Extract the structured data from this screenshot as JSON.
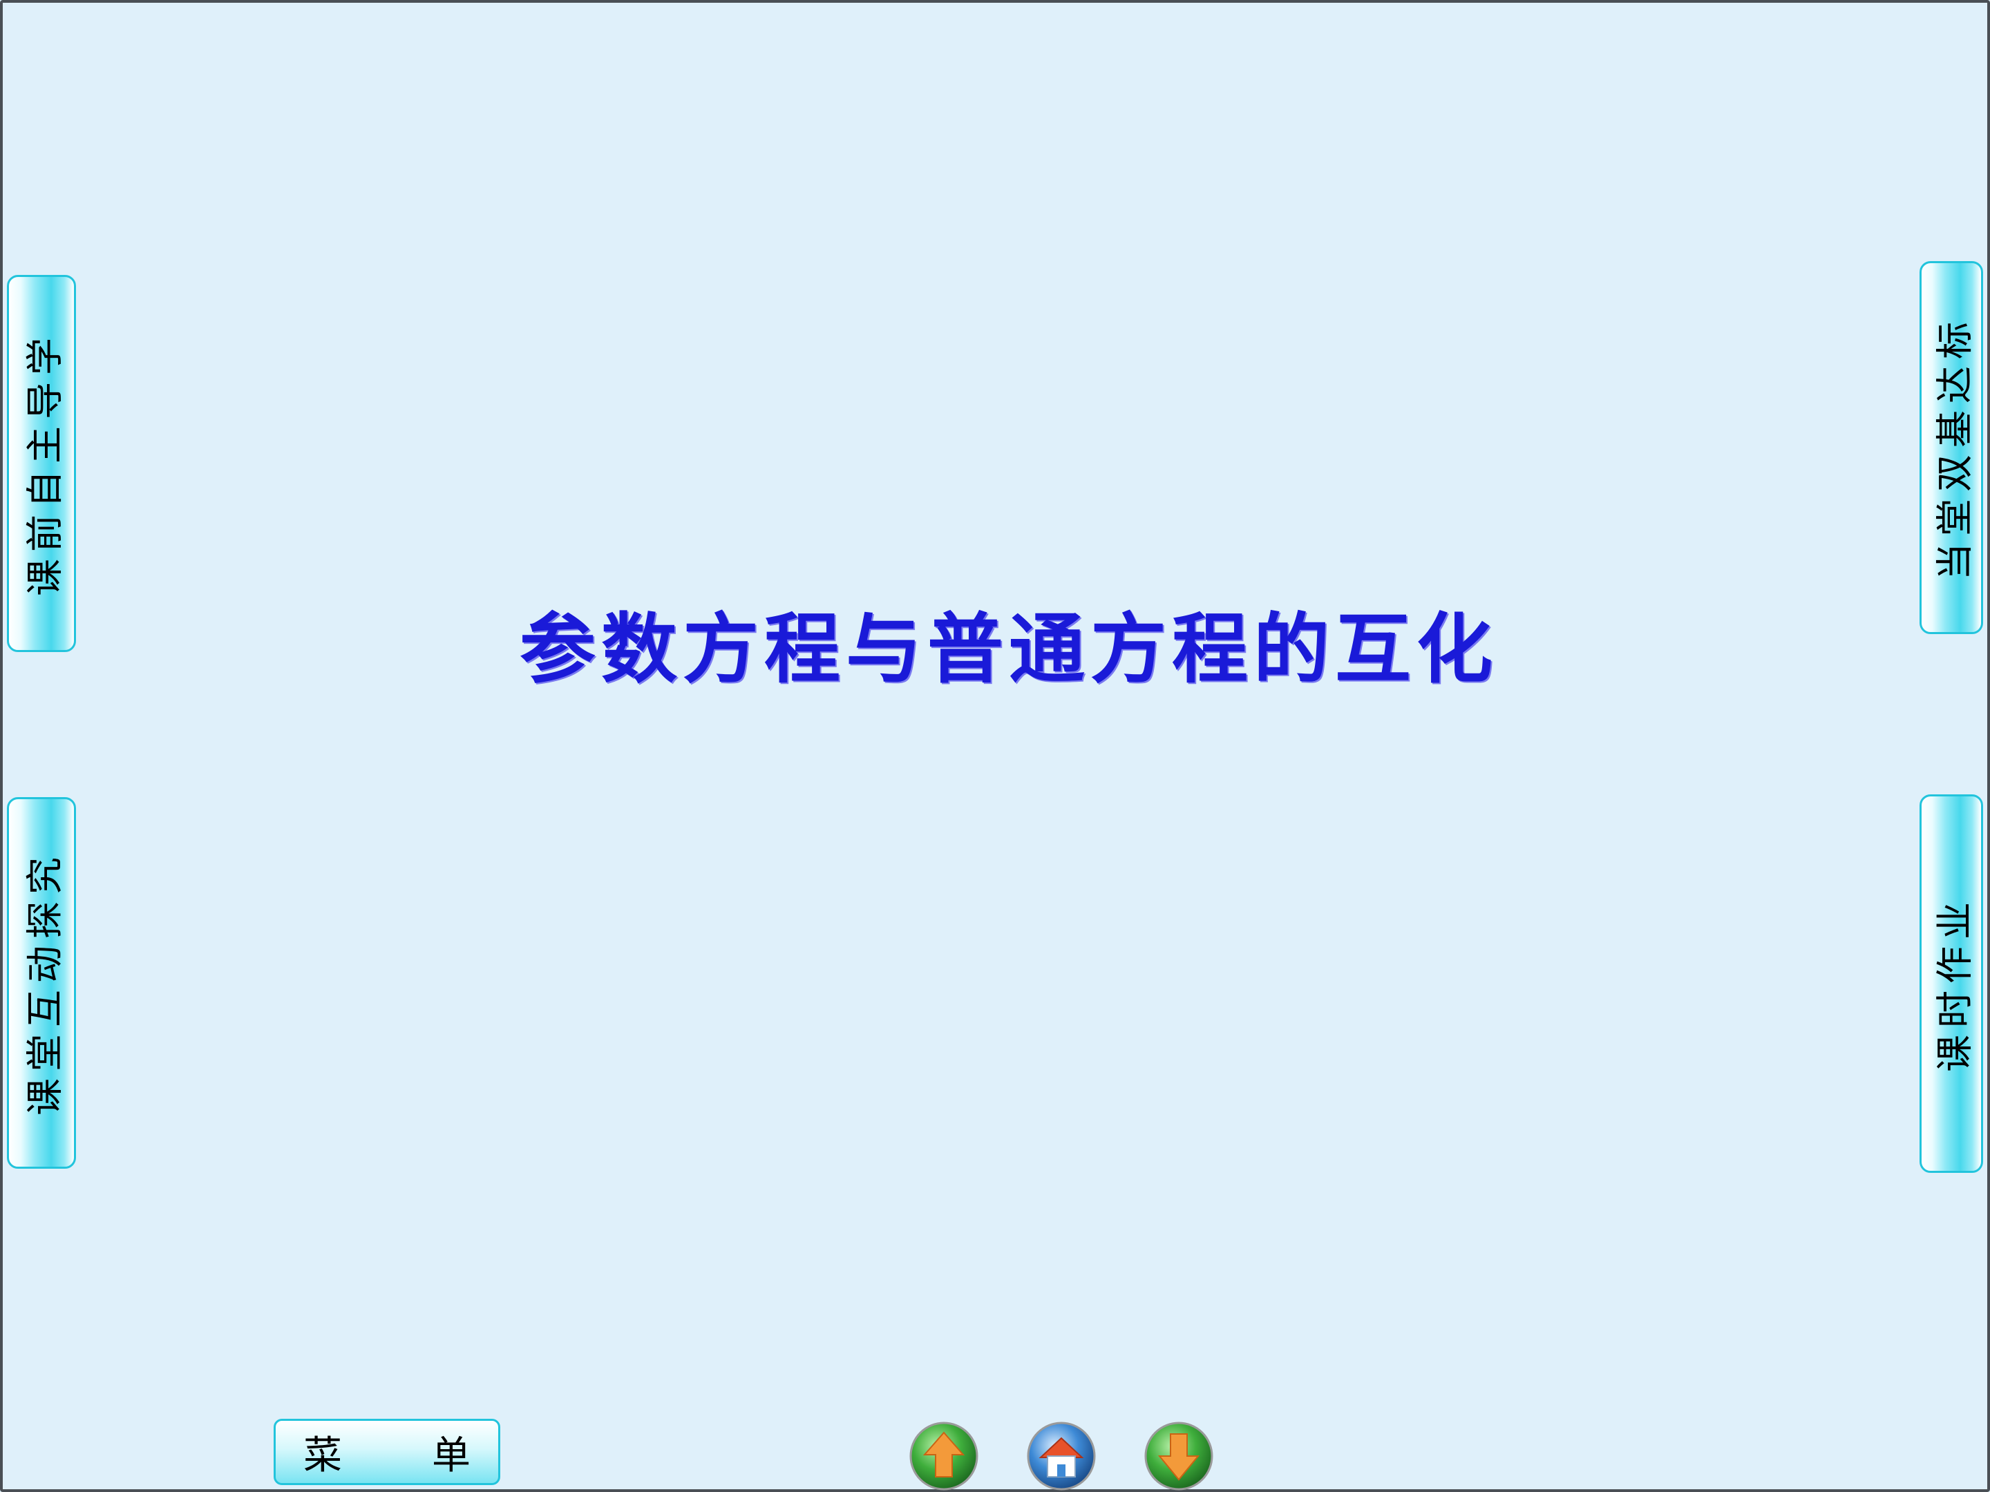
{
  "slide": {
    "title": "参数方程与普通方程的互化"
  },
  "side_tabs": {
    "left_top": "课前自主导学",
    "left_bottom": "课堂互动探究",
    "right_top": "当堂双基达标",
    "right_bottom": "课时作业"
  },
  "bottom_bar": {
    "menu_left": "菜",
    "menu_right": "单",
    "nav_icons": [
      "up-arrow-icon",
      "home-icon",
      "down-arrow-icon"
    ]
  },
  "colors": {
    "background": "#dff0fa",
    "title": "#1a1ad8",
    "tab_border": "#22c4dc",
    "nav_green": "#2ea03a",
    "nav_blue": "#2f7fd0",
    "arrow_orange": "#f08a2c"
  }
}
